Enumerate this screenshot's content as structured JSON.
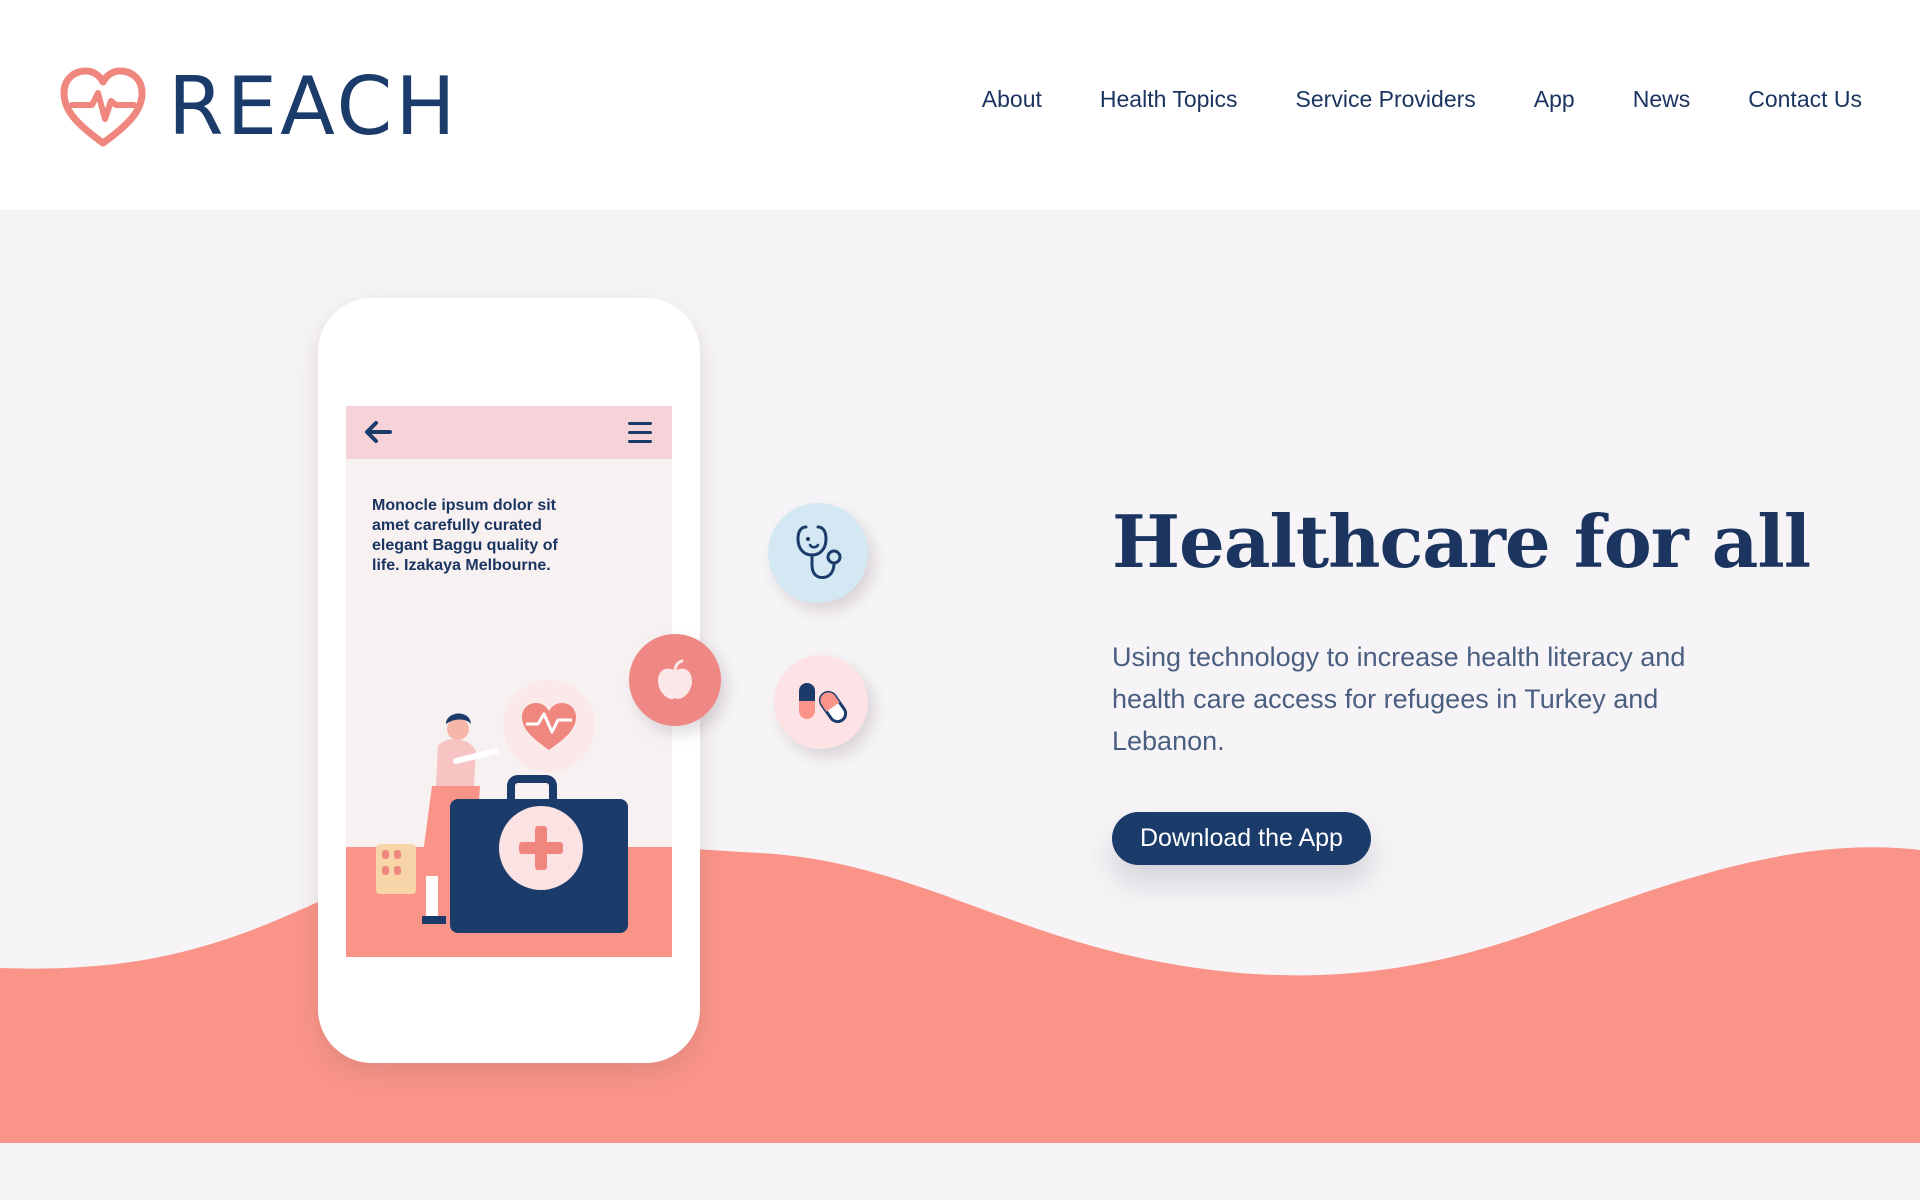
{
  "brand": {
    "name": "REACH",
    "accent_color": "#f0877f",
    "primary_color": "#1b3b6b",
    "logo_icon": "heart-pulse-icon"
  },
  "nav": {
    "items": [
      {
        "label": "About"
      },
      {
        "label": "Health Topics"
      },
      {
        "label": "Service Providers"
      },
      {
        "label": "App"
      },
      {
        "label": "News"
      },
      {
        "label": "Contact Us"
      }
    ]
  },
  "hero": {
    "title": "Healthcare for all",
    "subtitle": "Using technology to increase health literacy and health care access for refugees in Turkey and Lebanon.",
    "cta_label": "Download the App",
    "wave_color": "#fa9488"
  },
  "phone_mockup": {
    "screen_text": "Monocle ipsum dolor sit amet carefully curated elegant Baggu quality of life. Izakaya Melbourne.",
    "back_icon": "arrow-left-icon",
    "menu_icon": "hamburger-menu-icon"
  },
  "floating_icons": [
    {
      "name": "stethoscope-icon"
    },
    {
      "name": "apple-icon"
    },
    {
      "name": "pills-icon"
    },
    {
      "name": "heart-pulse-icon"
    },
    {
      "name": "medical-kit-icon"
    }
  ]
}
